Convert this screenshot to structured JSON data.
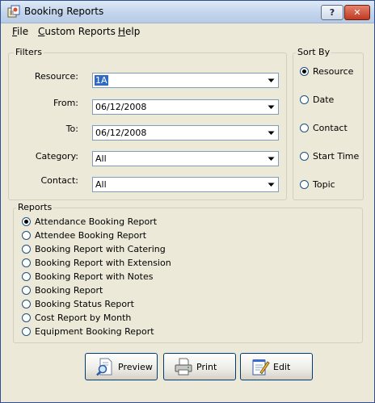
{
  "window": {
    "title": "Booking Reports"
  },
  "title_buttons": {
    "help": "?",
    "close": "✕"
  },
  "menu": [
    "File",
    "Custom Reports",
    "Help"
  ],
  "filters": {
    "label": "Filters",
    "fields": [
      {
        "label": "Resource:",
        "value": "1A",
        "selected": true
      },
      {
        "label": "From:",
        "value": "06/12/2008"
      },
      {
        "label": "To:",
        "value": "06/12/2008"
      },
      {
        "label": "Category:",
        "value": "All"
      },
      {
        "label": "Contact:",
        "value": "All"
      }
    ]
  },
  "sort_by": {
    "label": "Sort By",
    "options": [
      "Resource",
      "Date",
      "Contact",
      "Start Time",
      "Topic"
    ],
    "selected_index": 0
  },
  "reports": {
    "label": "Reports",
    "options": [
      "Attendance Booking Report",
      "Attendee Booking Report",
      "Booking Report with Catering",
      "Booking Report with Extension",
      "Booking Report with Notes",
      "Booking Report",
      "Booking Status Report",
      "Cost Report by Month",
      "Equipment Booking Report"
    ],
    "selected_index": 0
  },
  "actions": {
    "preview": "Preview",
    "print": "Print",
    "edit": "Edit"
  },
  "icons": {
    "app": "booking-app-icon",
    "preview": "magnifier-document-icon",
    "print": "printer-icon",
    "edit": "notepad-pencil-icon"
  }
}
